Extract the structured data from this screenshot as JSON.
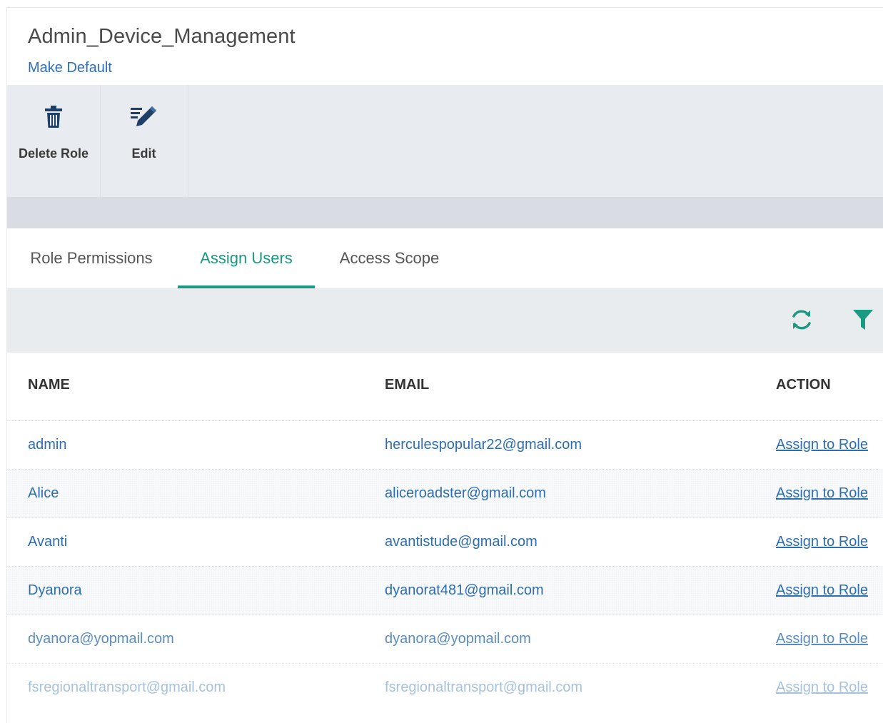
{
  "header": {
    "title": "Admin_Device_Management",
    "make_default": "Make Default"
  },
  "toolbar": {
    "delete_label": "Delete Role",
    "edit_label": "Edit"
  },
  "tabs": [
    {
      "label": "Role Permissions",
      "active": false
    },
    {
      "label": "Assign Users",
      "active": true
    },
    {
      "label": "Access Scope",
      "active": false
    }
  ],
  "table": {
    "columns": [
      "NAME",
      "EMAIL",
      "ACTION"
    ],
    "rows": [
      {
        "name": "admin",
        "email": "herculespopular22@gmail.com",
        "action": "Assign to Role"
      },
      {
        "name": "Alice",
        "email": "aliceroadster@gmail.com",
        "action": "Assign to Role"
      },
      {
        "name": "Avanti",
        "email": "avantistude@gmail.com",
        "action": "Assign to Role"
      },
      {
        "name": "Dyanora",
        "email": "dyanorat481@gmail.com",
        "action": "Assign to Role"
      },
      {
        "name": "dyanora@yopmail.com",
        "email": "dyanora@yopmail.com",
        "action": "Assign to Role"
      },
      {
        "name": "fsregionaltransport@gmail.com",
        "email": "fsregionaltransport@gmail.com",
        "action": "Assign to Role"
      }
    ]
  },
  "colors": {
    "accent": "#1a9a80",
    "link": "#2e6dae",
    "toolbar_bg": "#e8ebef"
  },
  "icons": {
    "delete": "trash-icon",
    "edit": "pencil-icon",
    "refresh": "refresh-icon",
    "filter": "filter-icon"
  }
}
